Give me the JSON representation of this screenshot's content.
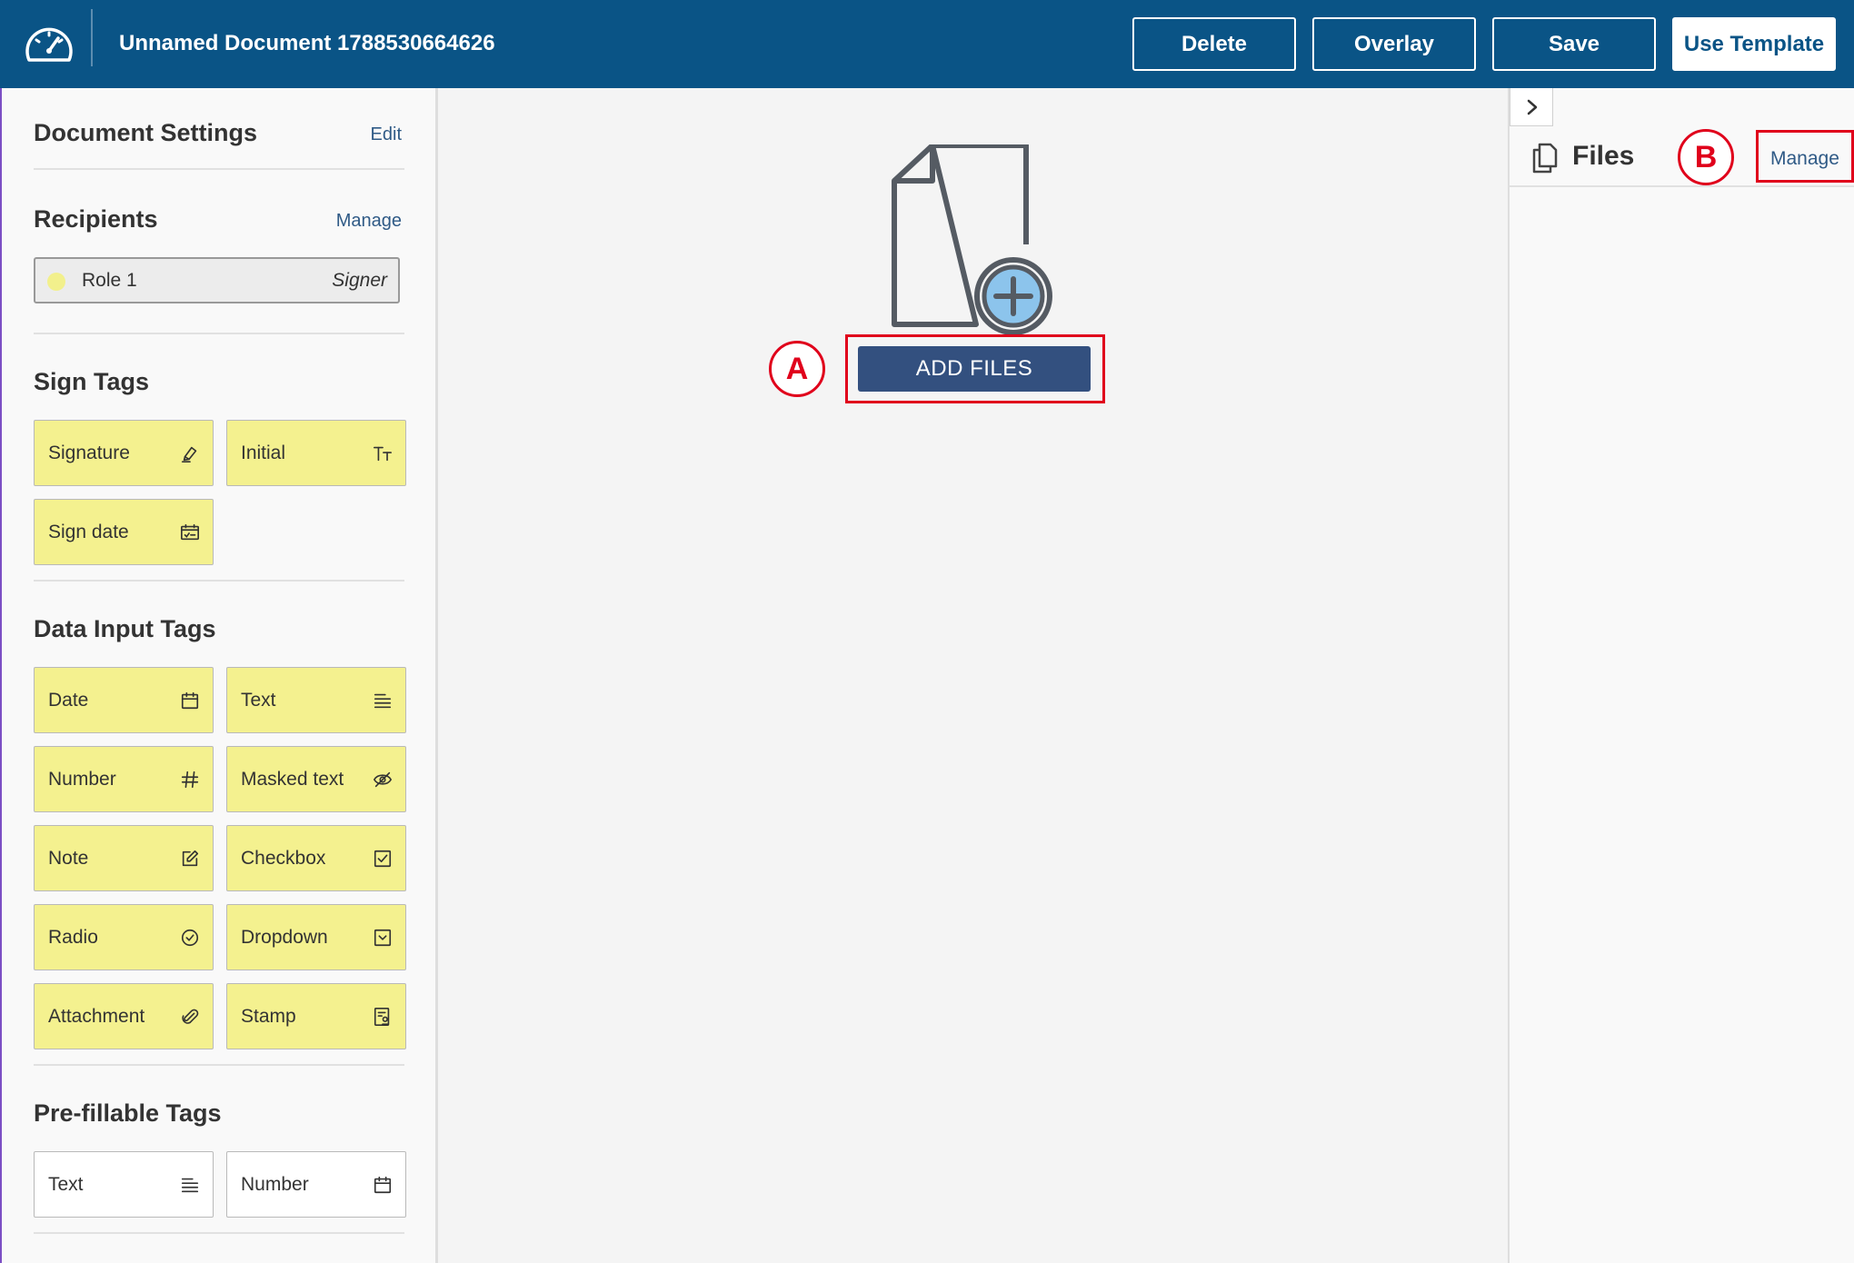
{
  "header": {
    "document_title": "Unnamed Document 1788530664626",
    "buttons": {
      "delete": "Delete",
      "overlay": "Overlay",
      "save": "Save",
      "use_template": "Use Template"
    }
  },
  "sidebar": {
    "document_settings": {
      "title": "Document Settings",
      "action": "Edit"
    },
    "recipients": {
      "title": "Recipients",
      "action": "Manage",
      "items": [
        {
          "name": "Role 1",
          "type": "Signer",
          "color": "#f2f08c"
        }
      ]
    },
    "sign_tags": {
      "title": "Sign Tags",
      "items": [
        {
          "label": "Signature",
          "icon": "signature-pen-icon"
        },
        {
          "label": "Initial",
          "icon": "initial-text-icon"
        },
        {
          "label": "Sign date",
          "icon": "sign-date-calendar-icon"
        }
      ]
    },
    "data_input_tags": {
      "title": "Data Input Tags",
      "items": [
        {
          "label": "Date",
          "icon": "calendar-icon"
        },
        {
          "label": "Text",
          "icon": "text-lines-icon"
        },
        {
          "label": "Number",
          "icon": "hash-icon"
        },
        {
          "label": "Masked text",
          "icon": "eye-slash-icon"
        },
        {
          "label": "Note",
          "icon": "note-edit-icon"
        },
        {
          "label": "Checkbox",
          "icon": "checkbox-icon"
        },
        {
          "label": "Radio",
          "icon": "radio-check-icon"
        },
        {
          "label": "Dropdown",
          "icon": "dropdown-icon"
        },
        {
          "label": "Attachment",
          "icon": "paperclip-icon"
        },
        {
          "label": "Stamp",
          "icon": "stamp-icon"
        }
      ]
    },
    "prefillable_tags": {
      "title": "Pre-fillable Tags",
      "items": [
        {
          "label": "Text",
          "icon": "text-lines-icon"
        },
        {
          "label": "Number",
          "icon": "calendar-icon"
        }
      ]
    }
  },
  "main": {
    "add_files_label": "ADD FILES",
    "annotations": {
      "a": "A",
      "b": "B"
    }
  },
  "files_panel": {
    "title": "Files",
    "action": "Manage"
  },
  "colors": {
    "header_bg": "#0a5486",
    "tag_yellow": "#f4f18f",
    "add_files_bg": "#33507f",
    "annotation_red": "#e0001b",
    "link": "#2f5a86"
  }
}
